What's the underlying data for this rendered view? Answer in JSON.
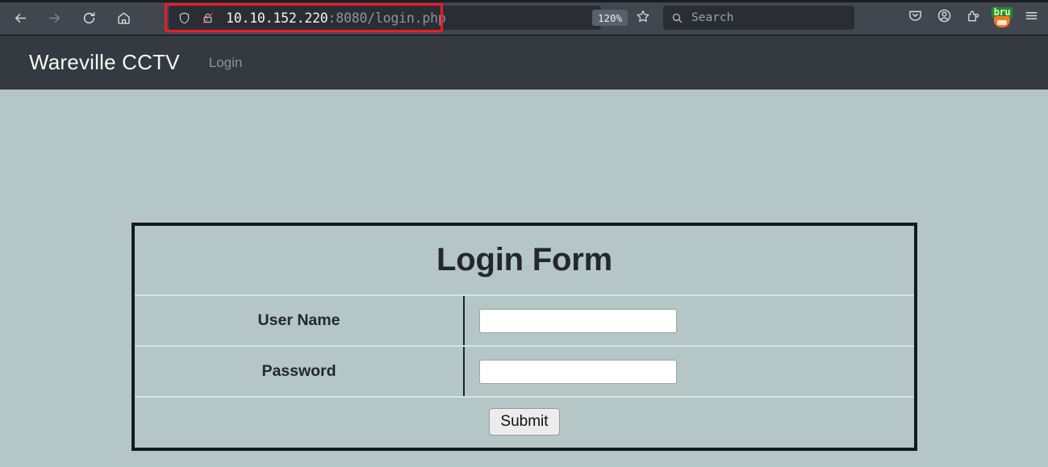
{
  "browser": {
    "nav": {
      "back_icon": "arrow-left-icon",
      "forward_icon": "arrow-right-icon",
      "reload_icon": "reload-icon",
      "home_icon": "home-icon"
    },
    "urlbar": {
      "shield_icon": "shield-icon",
      "lock_icon": "lock-crossed-out-icon",
      "url_host": "10.10.152.220",
      "url_rest": ":8080/login.php",
      "highlight_color": "#ee1c25"
    },
    "zoom_badge": "120%",
    "bookmark_icon": "star-icon",
    "search": {
      "icon": "search-icon",
      "placeholder": "Search"
    },
    "toolbar_right": {
      "pocket_icon": "pocket-icon",
      "account_icon": "account-circle-icon",
      "extensions_icon": "extensions-puzzle-icon",
      "bruno_icon_label": "bru",
      "menu_icon": "hamburger-menu-icon"
    }
  },
  "site": {
    "navbar": {
      "brand": "Wareville CCTV",
      "login_link": "Login"
    },
    "login_form": {
      "title": "Login Form",
      "rows": [
        {
          "label": "User Name",
          "value": "",
          "placeholder": ""
        },
        {
          "label": "Password",
          "value": "",
          "placeholder": ""
        }
      ],
      "submit_label": "Submit"
    },
    "colors": {
      "page_background": "#b4c6c6",
      "navbar_background": "#343a40",
      "card_border": "#141a1d"
    }
  }
}
